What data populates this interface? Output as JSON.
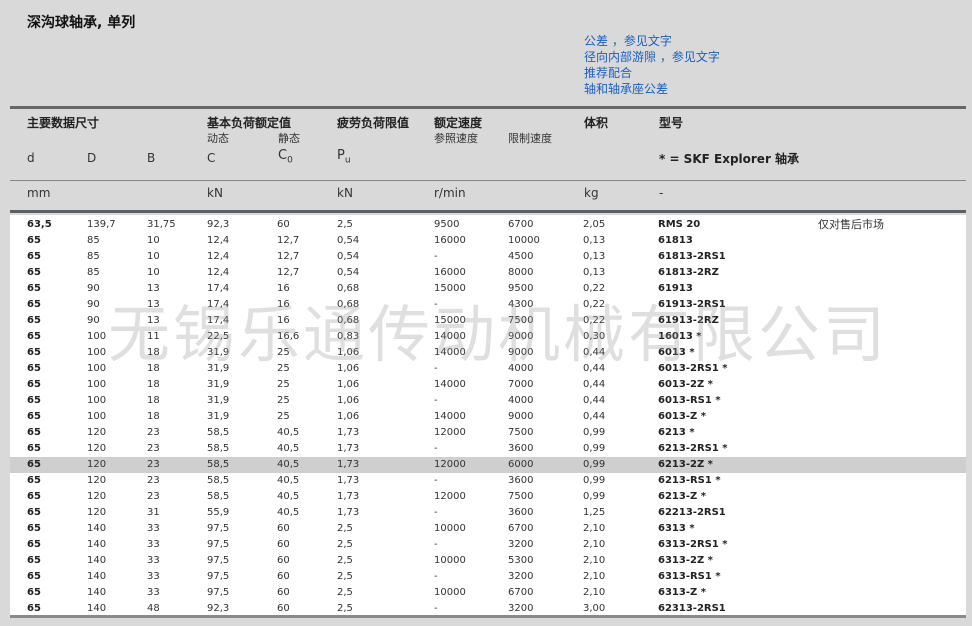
{
  "title": "深沟球轴承, 单列",
  "links": [
    "公差 ，参见文字",
    "径向内部游隙 ，参见文字",
    "推荐配合",
    "轴和轴承座公差"
  ],
  "headers": {
    "g1": "主要数据尺寸",
    "g2": "基本负荷额定值",
    "g2_dyn": "动态",
    "g2_stat": "静态",
    "g3": "疲劳负荷限值",
    "g4": "额定速度",
    "g4_ref": "参照速度",
    "g4_lim": "限制速度",
    "g5": "体积",
    "g6": "型号",
    "sym_d": "d",
    "sym_D": "D",
    "sym_B": "B",
    "sym_C": "C",
    "sym_C0": "C",
    "sym_C0_sub": "0",
    "sym_Pu": "P",
    "sym_Pu_sub": "u",
    "sym_model": "* = SKF Explorer 轴承",
    "u_mm": "mm",
    "u_kN1": "kN",
    "u_kN2": "kN",
    "u_rmin": "r/min",
    "u_kg": "kg",
    "u_dash": "-"
  },
  "note": "仅对售后市场",
  "watermark": "无锡乐通传动机械有限公司",
  "rows": [
    [
      "63,5",
      "139,7",
      "31,75",
      "92,3",
      "60",
      "2,5",
      "9500",
      "6700",
      "2,05",
      "RMS 20"
    ],
    [
      "65",
      "85",
      "10",
      "12,4",
      "12,7",
      "0,54",
      "16000",
      "10000",
      "0,13",
      "61813"
    ],
    [
      "65",
      "85",
      "10",
      "12,4",
      "12,7",
      "0,54",
      "-",
      "4500",
      "0,13",
      "61813-2RS1"
    ],
    [
      "65",
      "85",
      "10",
      "12,4",
      "12,7",
      "0,54",
      "16000",
      "8000",
      "0,13",
      "61813-2RZ"
    ],
    [
      "65",
      "90",
      "13",
      "17,4",
      "16",
      "0,68",
      "15000",
      "9500",
      "0,22",
      "61913"
    ],
    [
      "65",
      "90",
      "13",
      "17,4",
      "16",
      "0,68",
      "-",
      "4300",
      "0,22",
      "61913-2RS1"
    ],
    [
      "65",
      "90",
      "13",
      "17,4",
      "16",
      "0,68",
      "15000",
      "7500",
      "0,22",
      "61913-2RZ"
    ],
    [
      "65",
      "100",
      "11",
      "22,5",
      "16,6",
      "0,83",
      "14000",
      "9000",
      "0,30",
      "16013 *"
    ],
    [
      "65",
      "100",
      "18",
      "31,9",
      "25",
      "1,06",
      "14000",
      "9000",
      "0,44",
      "6013 *"
    ],
    [
      "65",
      "100",
      "18",
      "31,9",
      "25",
      "1,06",
      "-",
      "4000",
      "0,44",
      "6013-2RS1 *"
    ],
    [
      "65",
      "100",
      "18",
      "31,9",
      "25",
      "1,06",
      "14000",
      "7000",
      "0,44",
      "6013-2Z *"
    ],
    [
      "65",
      "100",
      "18",
      "31,9",
      "25",
      "1,06",
      "-",
      "4000",
      "0,44",
      "6013-RS1 *"
    ],
    [
      "65",
      "100",
      "18",
      "31,9",
      "25",
      "1,06",
      "14000",
      "9000",
      "0,44",
      "6013-Z *"
    ],
    [
      "65",
      "120",
      "23",
      "58,5",
      "40,5",
      "1,73",
      "12000",
      "7500",
      "0,99",
      "6213 *"
    ],
    [
      "65",
      "120",
      "23",
      "58,5",
      "40,5",
      "1,73",
      "-",
      "3600",
      "0,99",
      "6213-2RS1 *"
    ],
    [
      "65",
      "120",
      "23",
      "58,5",
      "40,5",
      "1,73",
      "12000",
      "6000",
      "0,99",
      "6213-2Z *"
    ],
    [
      "65",
      "120",
      "23",
      "58,5",
      "40,5",
      "1,73",
      "-",
      "3600",
      "0,99",
      "6213-RS1 *"
    ],
    [
      "65",
      "120",
      "23",
      "58,5",
      "40,5",
      "1,73",
      "12000",
      "7500",
      "0,99",
      "6213-Z *"
    ],
    [
      "65",
      "120",
      "31",
      "55,9",
      "40,5",
      "1,73",
      "-",
      "3600",
      "1,25",
      "62213-2RS1"
    ],
    [
      "65",
      "140",
      "33",
      "97,5",
      "60",
      "2,5",
      "10000",
      "6700",
      "2,10",
      "6313 *"
    ],
    [
      "65",
      "140",
      "33",
      "97,5",
      "60",
      "2,5",
      "-",
      "3200",
      "2,10",
      "6313-2RS1 *"
    ],
    [
      "65",
      "140",
      "33",
      "97,5",
      "60",
      "2,5",
      "10000",
      "5300",
      "2,10",
      "6313-2Z *"
    ],
    [
      "65",
      "140",
      "33",
      "97,5",
      "60",
      "2,5",
      "-",
      "3200",
      "2,10",
      "6313-RS1 *"
    ],
    [
      "65",
      "140",
      "33",
      "97,5",
      "60",
      "2,5",
      "10000",
      "6700",
      "2,10",
      "6313-Z *"
    ],
    [
      "65",
      "140",
      "48",
      "92,3",
      "60",
      "2,5",
      "-",
      "3200",
      "3,00",
      "62313-2RS1"
    ]
  ]
}
